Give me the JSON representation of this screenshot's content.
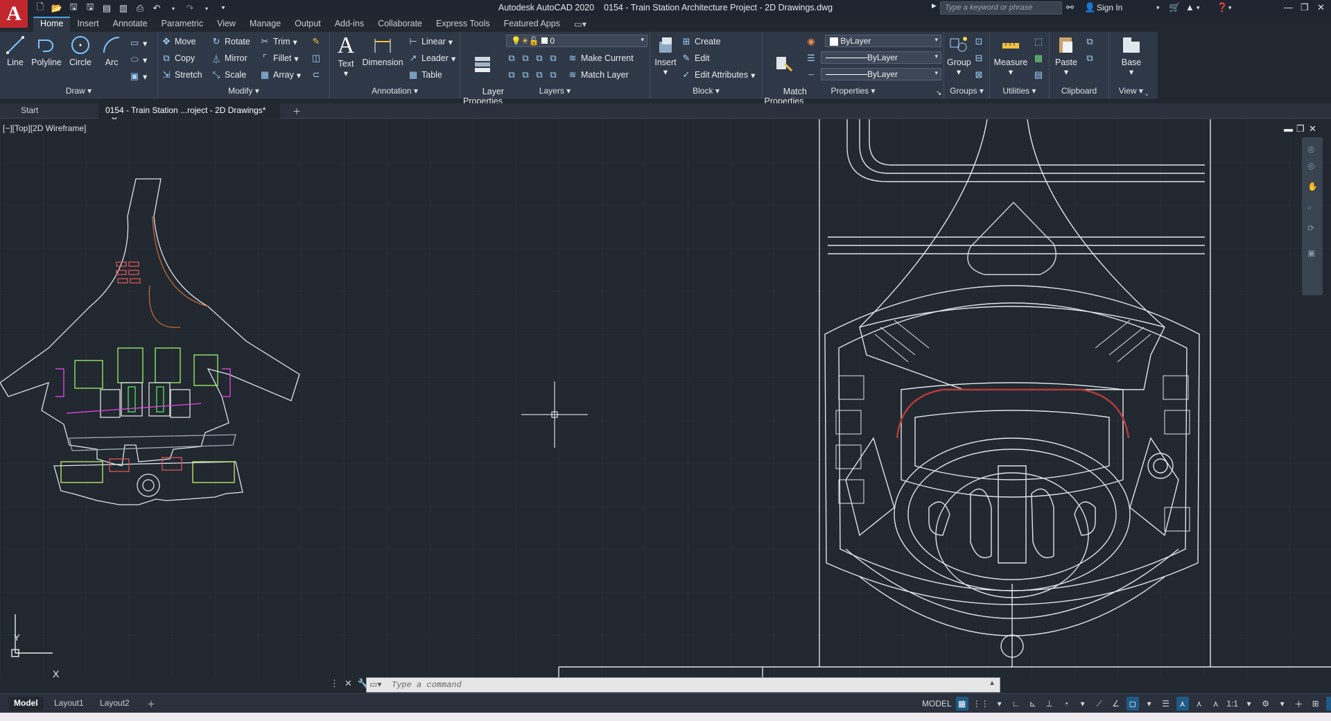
{
  "app": {
    "logo": "A",
    "title": "Autodesk AutoCAD 2020    0154 - Train Station Architecture Project - 2D Drawings.dwg"
  },
  "search": {
    "placeholder": "Type a keyword or phrase"
  },
  "account": {
    "sign_in": "Sign In"
  },
  "ribbon_tabs": [
    "Home",
    "Insert",
    "Annotate",
    "Parametric",
    "View",
    "Manage",
    "Output",
    "Add-ins",
    "Collaborate",
    "Express Tools",
    "Featured Apps"
  ],
  "draw": {
    "title": "Draw",
    "line": "Line",
    "polyline": "Polyline",
    "circle": "Circle",
    "arc": "Arc"
  },
  "modify": {
    "title": "Modify",
    "move": "Move",
    "rotate": "Rotate",
    "trim": "Trim",
    "copy": "Copy",
    "mirror": "Mirror",
    "fillet": "Fillet",
    "stretch": "Stretch",
    "scale": "Scale",
    "array": "Array"
  },
  "annotation": {
    "title": "Annotation",
    "text": "Text",
    "dimension": "Dimension",
    "linear": "Linear",
    "leader": "Leader",
    "table": "Table"
  },
  "layers": {
    "title": "Layers",
    "layer_properties": "Layer\nProperties",
    "current_layer": "0",
    "make_current": "Make Current",
    "match_layer": "Match Layer"
  },
  "block": {
    "title": "Block",
    "insert": "Insert",
    "create": "Create",
    "edit": "Edit",
    "edit_attributes": "Edit Attributes"
  },
  "properties": {
    "title": "Properties",
    "match": "Match\nProperties",
    "color": "ByLayer",
    "linetype": "ByLayer",
    "lineweight": "ByLayer"
  },
  "groups": {
    "title": "Groups",
    "group": "Group"
  },
  "utilities": {
    "title": "Utilities",
    "measure": "Measure"
  },
  "clipboard": {
    "title": "Clipboard",
    "paste": "Paste"
  },
  "view_panel": {
    "title": "View",
    "base": "Base"
  },
  "doc_tabs": {
    "start": "Start",
    "active": "0154 - Train Station ...roject - 2D Drawings*"
  },
  "viewport": {
    "label": "[−][Top][2D Wireframe]",
    "axis_y": "Y",
    "axis_x": "X"
  },
  "command": {
    "placeholder": "Type a command"
  },
  "layout_tabs": [
    "Model",
    "Layout1",
    "Layout2"
  ],
  "status": {
    "model": "MODEL",
    "scale": "1:1"
  },
  "colors": {
    "accent": "#4aa3df",
    "canvas": "#212830",
    "ribbon": "#2f3846",
    "logo": "#c1272d"
  }
}
